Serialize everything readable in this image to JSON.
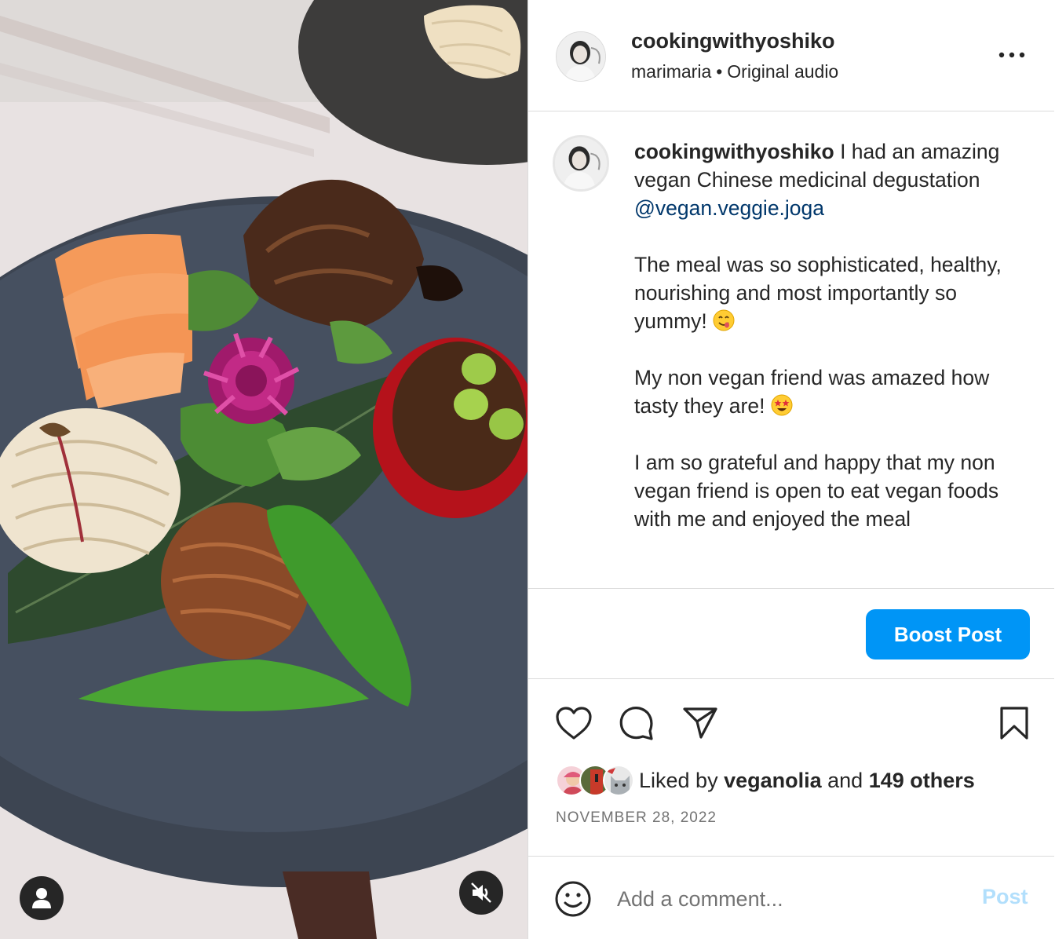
{
  "post": {
    "username": "cookingwithyoshiko",
    "audio_artist": "marimaria",
    "separator": "•",
    "audio_label": "Original audio",
    "more_icon": "ellipsis-icon"
  },
  "caption": {
    "username": "cookingwithyoshiko",
    "line1_text": " I had an amazing vegan Chinese medicinal degustation ",
    "mention": "@vegan.veggie.joga",
    "para2": "The meal was so sophisticated, healthy, nourishing and most importantly so yummy! ",
    "para2_emoji": "face-savoring-food-emoji",
    "para3": "My non vegan friend was amazed how tasty they are! ",
    "para3_emoji": "star-struck-emoji",
    "para4": "I am so grateful and happy that my non vegan friend is open to eat vegan foods with me and enjoyed the meal"
  },
  "boost": {
    "label": "Boost Post",
    "color": "#0095f6"
  },
  "actions": {
    "like_icon": "heart-icon",
    "comment_icon": "comment-icon",
    "share_icon": "paper-plane-icon",
    "save_icon": "bookmark-icon"
  },
  "likes": {
    "prefix": "Liked by ",
    "user": "veganolia",
    "middle": " and ",
    "others": "149 others"
  },
  "date": "NOVEMBER 28, 2022",
  "comment": {
    "placeholder": "Add a comment...",
    "post_label": "Post",
    "emoji_icon": "smiley-icon"
  },
  "media": {
    "user_tag_icon": "user-icon",
    "mute_icon": "speaker-muted-icon"
  }
}
